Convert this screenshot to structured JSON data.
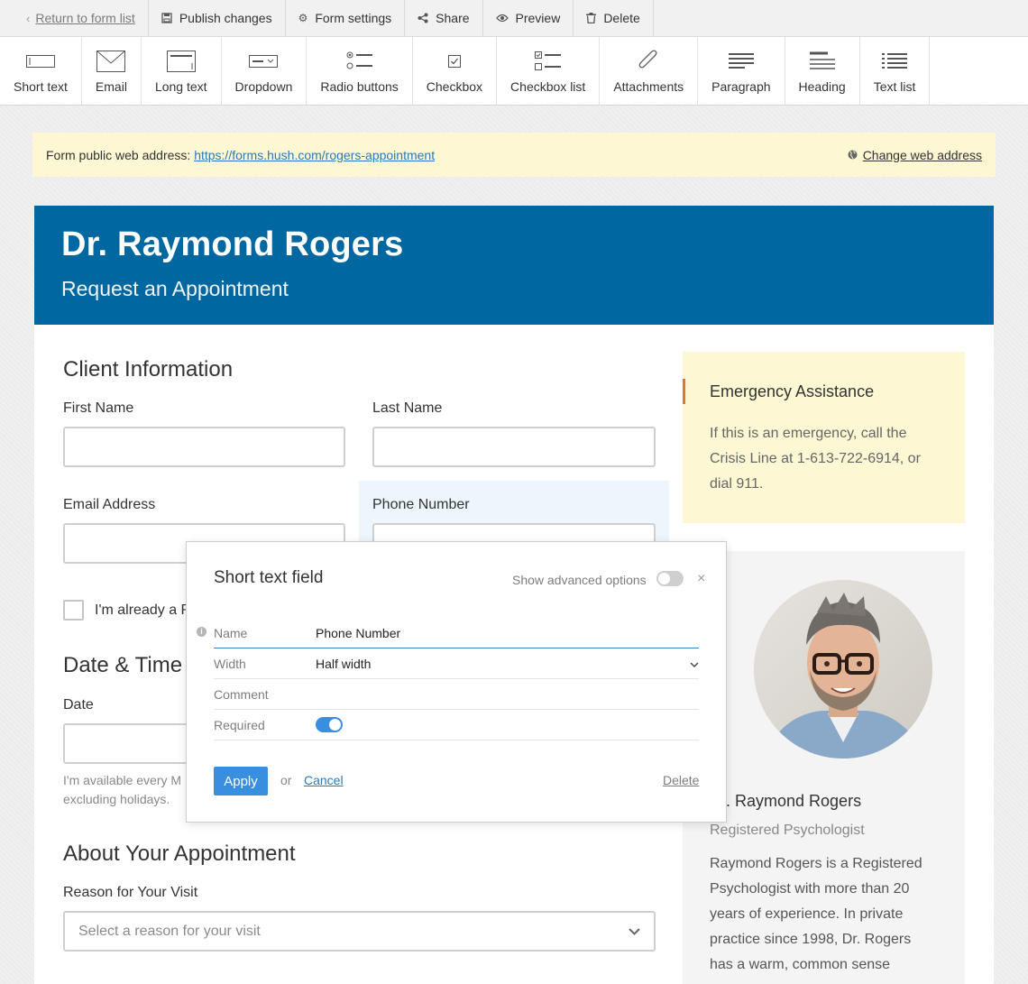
{
  "topbar": {
    "back": "Return to form list",
    "publish": "Publish changes",
    "settings": "Form settings",
    "share": "Share",
    "preview": "Preview",
    "delete": "Delete"
  },
  "palette": [
    {
      "label": "Short text",
      "icon": "short-text-icon"
    },
    {
      "label": "Email",
      "icon": "envelope-icon"
    },
    {
      "label": "Long text",
      "icon": "long-text-icon"
    },
    {
      "label": "Dropdown",
      "icon": "dropdown-icon"
    },
    {
      "label": "Radio buttons",
      "icon": "radio-buttons-icon"
    },
    {
      "label": "Checkbox",
      "icon": "checkbox-icon"
    },
    {
      "label": "Checkbox list",
      "icon": "checkbox-list-icon"
    },
    {
      "label": "Attachments",
      "icon": "paperclip-icon"
    },
    {
      "label": "Paragraph",
      "icon": "paragraph-icon"
    },
    {
      "label": "Heading",
      "icon": "heading-icon"
    },
    {
      "label": "Text list",
      "icon": "text-list-icon"
    }
  ],
  "address": {
    "label": "Form public web address:",
    "url": "https://forms.hush.com/rogers-appointment",
    "change": "Change web address"
  },
  "form": {
    "title": "Dr. Raymond Rogers",
    "subtitle": "Request an Appointment",
    "section_client": "Client Information",
    "first_name": "First Name",
    "last_name": "Last Name",
    "email": "Email Address",
    "phone": "Phone Number",
    "already_client": "I'm already a R",
    "section_date": "Date & Time",
    "date": "Date",
    "date_hint_1": "I'm available every M",
    "date_hint_2": "excluding holidays.",
    "section_about": "About Your Appointment",
    "reason_label": "Reason for Your Visit",
    "reason_placeholder": "Select a reason for your visit"
  },
  "sidebar": {
    "emergency_title": "Emergency Assistance",
    "emergency_text": "If this is an emergency, call the Crisis Line at 1-613-722-6914, or dial 911.",
    "name": "Dr. Raymond Rogers",
    "role": "Registered Psychologist",
    "description": "Raymond Rogers is a Registered Psychologist with more than 20 years of experience. In private practice since 1998, Dr. Rogers has a warm, common sense"
  },
  "popup": {
    "title": "Short text field",
    "advanced": "Show advanced options",
    "advanced_enabled": false,
    "rows": {
      "name_label": "Name",
      "name_value": "Phone Number",
      "width_label": "Width",
      "width_value": "Half width",
      "comment_label": "Comment",
      "comment_value": "",
      "required_label": "Required"
    },
    "required": true,
    "apply": "Apply",
    "or": "or",
    "cancel": "Cancel",
    "delete": "Delete"
  },
  "colors": {
    "header_blue": "#0067a0",
    "accent_blue": "#3a8ee0",
    "notice_yellow": "#fdf7d3",
    "emergency_accent": "#e27a27"
  }
}
